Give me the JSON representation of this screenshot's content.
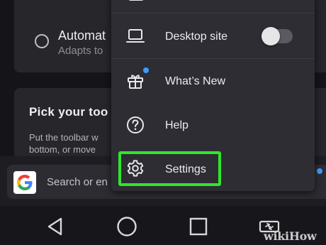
{
  "background": {
    "automatic_option": {
      "title": "Automat",
      "subtitle": "Adapts to"
    },
    "toolbar_section": {
      "title": "Pick your too",
      "description": "Put the toolbar w\nbottom, or move"
    },
    "search": {
      "placeholder": "Search or en",
      "engine_icon": "google-g-icon"
    }
  },
  "menu": {
    "items": [
      {
        "label": "Desktop site",
        "icon": "laptop-icon",
        "toggle": false
      },
      {
        "label": "What’s New",
        "icon": "gift-icon",
        "badge": true
      },
      {
        "label": "Help",
        "icon": "help-circle-icon"
      },
      {
        "label": "Settings",
        "icon": "gear-icon",
        "highlighted": true
      }
    ]
  },
  "navbar": {
    "buttons": [
      "back-triangle-icon",
      "home-circle-icon",
      "recents-square-icon",
      "rotate-icon"
    ]
  },
  "watermark": {
    "text": "wikiHow"
  },
  "colors": {
    "highlight": "#2fe62b",
    "badge": "#3d9bff",
    "menu_bg": "#2d2d33"
  }
}
